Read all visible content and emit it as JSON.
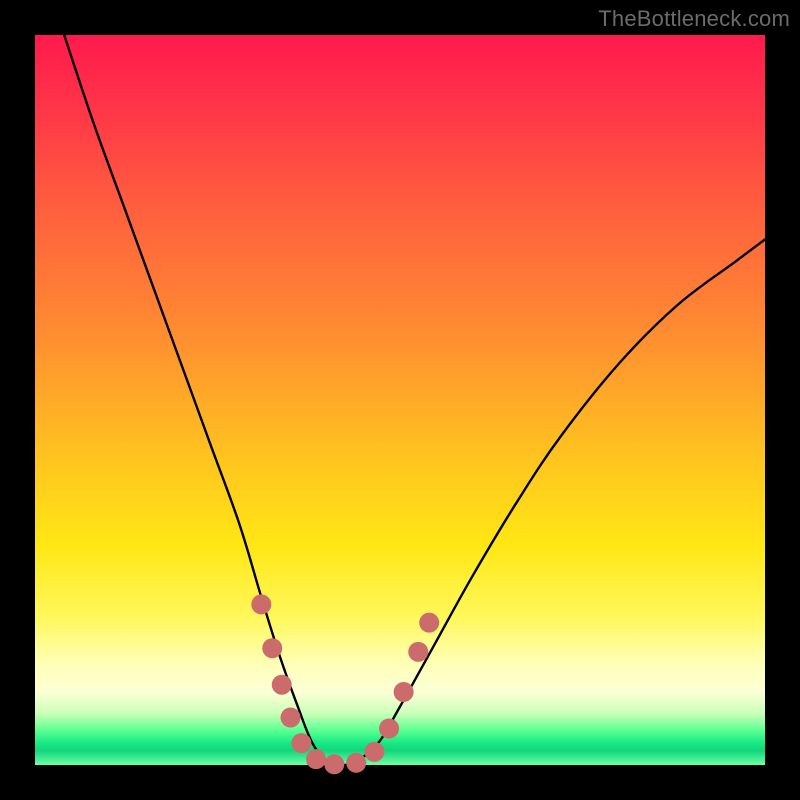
{
  "attribution": "TheBottleneck.com",
  "chart_data": {
    "type": "line",
    "title": "",
    "xlabel": "",
    "ylabel": "",
    "xlim": [
      0,
      100
    ],
    "ylim": [
      0,
      100
    ],
    "series": [
      {
        "name": "bottleneck-curve",
        "x": [
          4,
          8,
          12,
          16,
          20,
          24,
          28,
          31,
          33.5,
          36,
          38,
          40,
          42,
          44,
          47,
          50,
          55,
          60,
          66,
          72,
          80,
          88,
          96,
          100
        ],
        "y": [
          100,
          88,
          77,
          66,
          55,
          44,
          33,
          23,
          15,
          8,
          3,
          0.5,
          0,
          0.5,
          3,
          8,
          17,
          26,
          36,
          45,
          55,
          63,
          69,
          72
        ]
      }
    ],
    "markers": {
      "name": "highlight-dots",
      "color": "#cc6b6b",
      "points": [
        {
          "x": 31.0,
          "y": 22
        },
        {
          "x": 32.5,
          "y": 16
        },
        {
          "x": 33.8,
          "y": 11
        },
        {
          "x": 35.0,
          "y": 6.5
        },
        {
          "x": 36.5,
          "y": 3.0
        },
        {
          "x": 38.5,
          "y": 0.8
        },
        {
          "x": 41.0,
          "y": 0.1
        },
        {
          "x": 44.0,
          "y": 0.3
        },
        {
          "x": 46.5,
          "y": 1.8
        },
        {
          "x": 48.5,
          "y": 5.0
        },
        {
          "x": 50.5,
          "y": 10.0
        },
        {
          "x": 52.5,
          "y": 15.5
        },
        {
          "x": 54.0,
          "y": 19.5
        }
      ]
    }
  }
}
